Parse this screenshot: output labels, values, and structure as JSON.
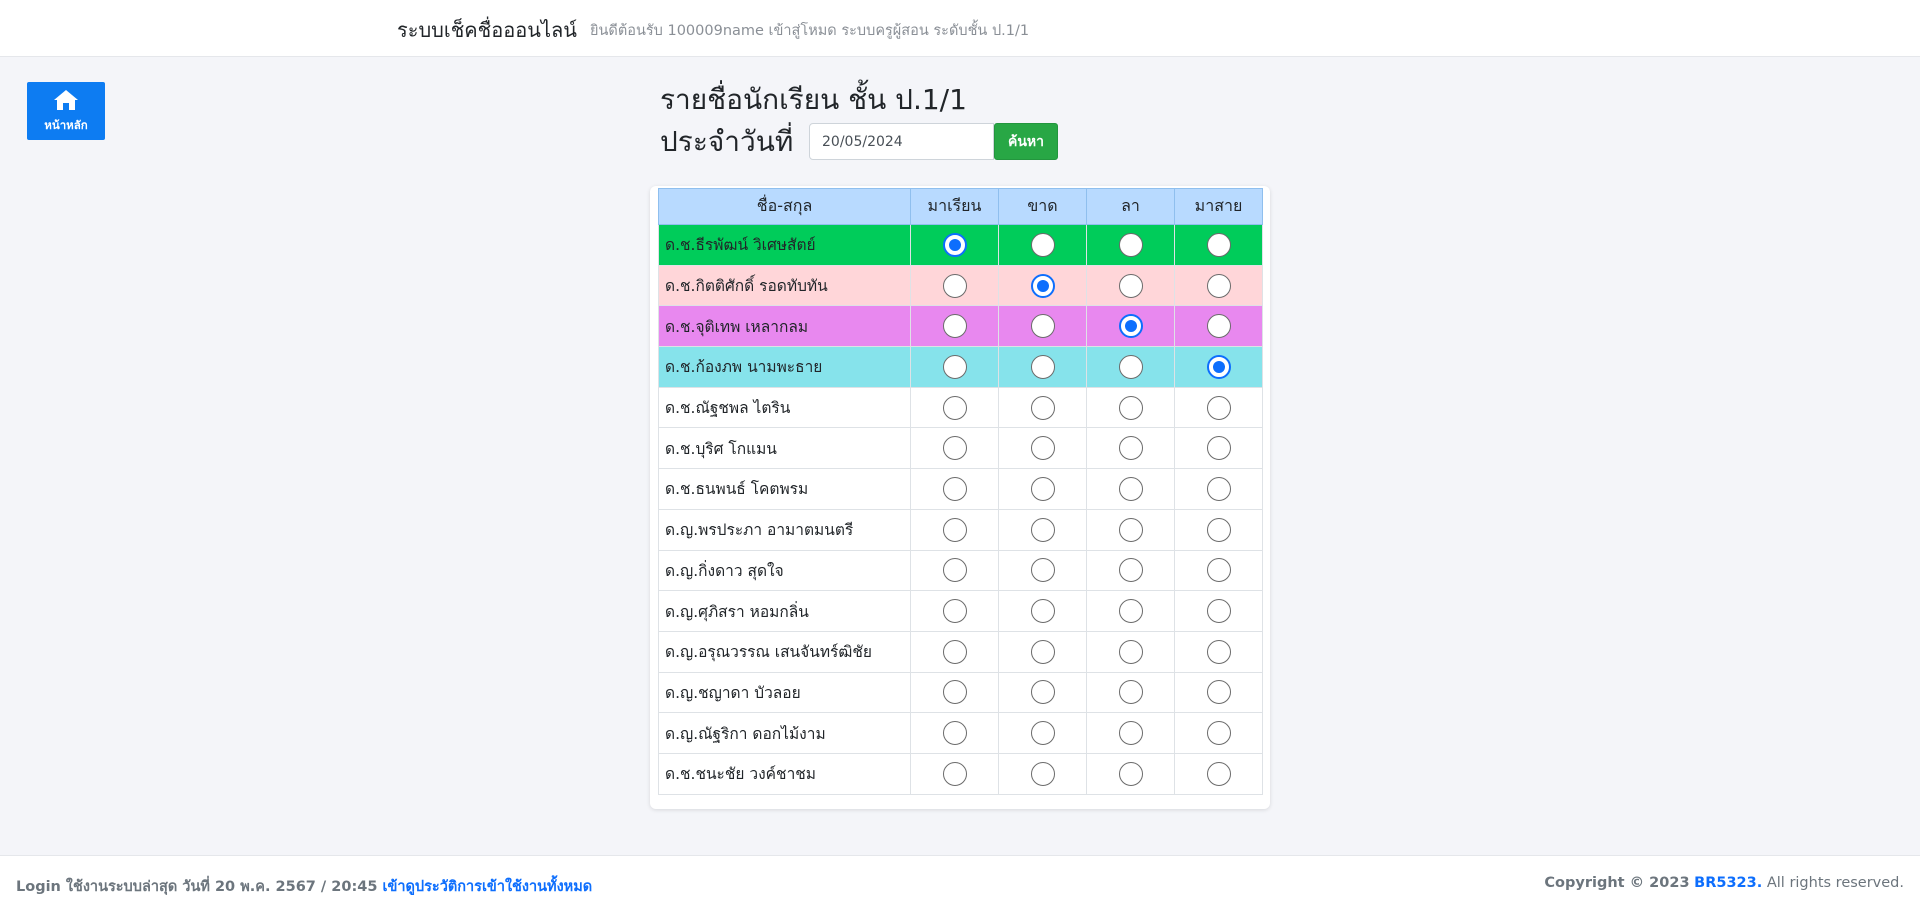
{
  "navbar": {
    "brand": "ระบบเช็คชื่อออนไลน์",
    "welcome": "ยินดีต้อนรับ 100009name เข้าสู่โหมด ระบบครูผู้สอน ระดับชั้น ป.1/1"
  },
  "home_button": {
    "label": "หน้าหลัก",
    "icon": "home-icon"
  },
  "page": {
    "title": "รายชื่อนักเรียน ชั้น ป.1/1",
    "date_label": "ประจำวันที่",
    "date_value": "20/05/2024",
    "search_label": "ค้นหา"
  },
  "table": {
    "headers": [
      "ชื่อ-สกุล",
      "มาเรียน",
      "ขาด",
      "ลา",
      "มาสาย"
    ],
    "rows": [
      {
        "name": "ด.ช.ธีรพัฒน์ วิเศษสัตย์",
        "status": 0,
        "row_color": "#00cc5a"
      },
      {
        "name": "ด.ช.กิตติศักดิ์ รอดทับทัน",
        "status": 1,
        "row_color": "#ffd6d9"
      },
      {
        "name": "ด.ช.จุติเทพ เหลากลม",
        "status": 2,
        "row_color": "#e888ef"
      },
      {
        "name": "ด.ช.ก้องภพ นามพะธาย",
        "status": 3,
        "row_color": "#86e3eb"
      },
      {
        "name": "ด.ช.ณัฐชพล ไตริน",
        "status": null,
        "row_color": "#ffffff"
      },
      {
        "name": "ด.ช.บุริศ โกแมน",
        "status": null,
        "row_color": "#ffffff"
      },
      {
        "name": "ด.ช.ธนพนธ์ โคตพรม",
        "status": null,
        "row_color": "#ffffff"
      },
      {
        "name": "ด.ญ.พรประภา อามาตมนตรี",
        "status": null,
        "row_color": "#ffffff"
      },
      {
        "name": "ด.ญ.กิ่งดาว สุดใจ",
        "status": null,
        "row_color": "#ffffff"
      },
      {
        "name": "ด.ญ.ศุภิสรา หอมกลิ่น",
        "status": null,
        "row_color": "#ffffff"
      },
      {
        "name": "ด.ญ.อรุณวรรณ เสนจันทร์ฒิชัย",
        "status": null,
        "row_color": "#ffffff"
      },
      {
        "name": "ด.ญ.ชญาดา บัวลอย",
        "status": null,
        "row_color": "#ffffff"
      },
      {
        "name": "ด.ญ.ณัฐริกา ดอกไม้งาม",
        "status": null,
        "row_color": "#ffffff"
      },
      {
        "name": "ด.ช.ชนะชัย วงค์ชาชม",
        "status": null,
        "row_color": "#ffffff"
      }
    ]
  },
  "footer": {
    "login_text": "Login ใช้งานระบบล่าสุด วันที่ 20 พ.ค. 2567 / 20:45",
    "history_link": "เข้าดูประวัติการเข้าใช้งานทั้งหมด",
    "copyright": "Copyright © 2023",
    "brand": "BR5323.",
    "rights": "All rights reserved."
  },
  "colors": {
    "primary": "#0d7cf2",
    "success": "#28a745",
    "header_bg": "#b8daff"
  }
}
